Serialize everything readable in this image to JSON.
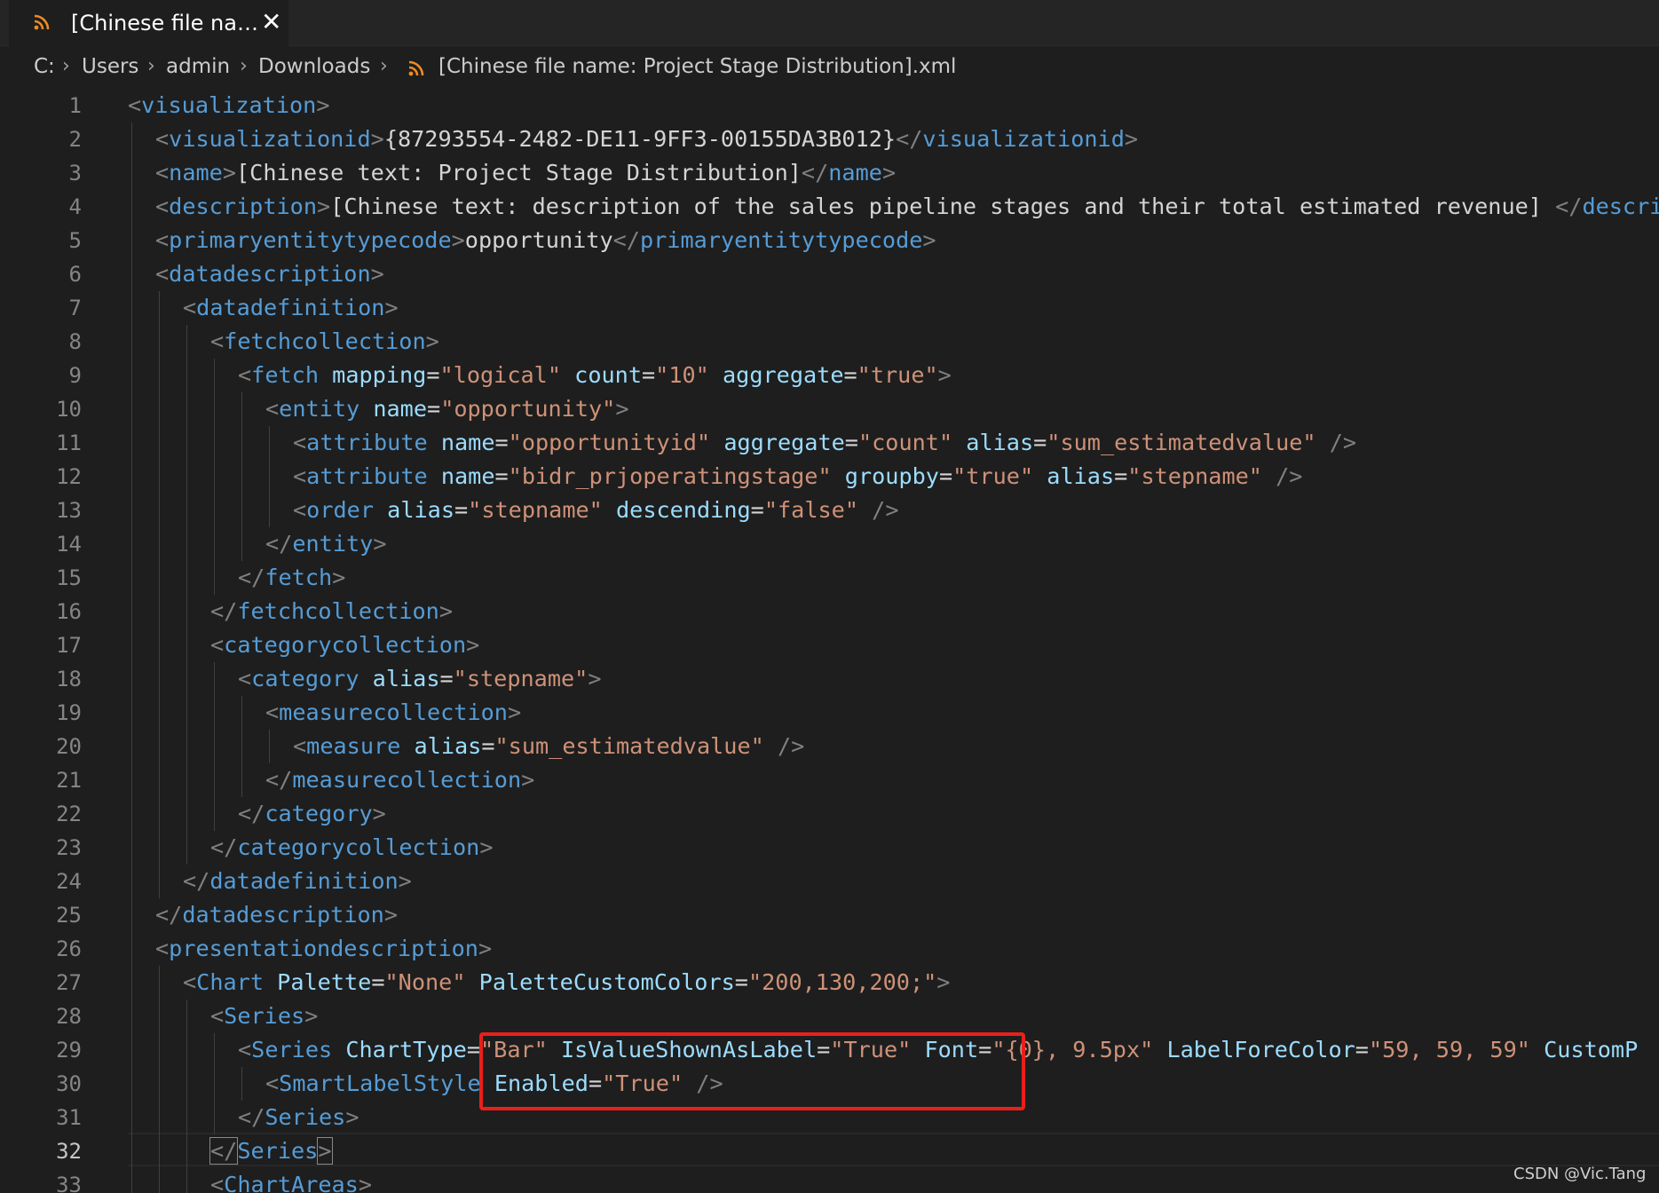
{
  "tab": {
    "title": "[Chinese file name: Project Stage Distribution].xml",
    "close_glyph": "✕"
  },
  "breadcrumb": {
    "items": [
      "C:",
      "Users",
      "admin",
      "Downloads"
    ],
    "file": "[Chinese file name: Project Stage Distribution].xml"
  },
  "editor": {
    "active_line": 32,
    "lines": [
      {
        "n": "1",
        "tokens": [
          [
            "p",
            "<"
          ],
          [
            "tag",
            "visualization"
          ],
          [
            "p",
            ">"
          ]
        ]
      },
      {
        "n": "2",
        "tokens": [
          [
            "p",
            "<"
          ],
          [
            "tag",
            "visualizationid"
          ],
          [
            "p",
            ">"
          ],
          [
            "txt",
            "{87293554-2482-DE11-9FF3-00155DA3B012}"
          ],
          [
            "p",
            "</"
          ],
          [
            "tag",
            "visualizationid"
          ],
          [
            "p",
            ">"
          ]
        ]
      },
      {
        "n": "3",
        "tokens": [
          [
            "p",
            "<"
          ],
          [
            "tag",
            "name"
          ],
          [
            "p",
            ">"
          ],
          [
            "txt",
            "[Chinese text: Project Stage Distribution]"
          ],
          [
            "p",
            "</"
          ],
          [
            "tag",
            "name"
          ],
          [
            "p",
            ">"
          ]
        ]
      },
      {
        "n": "4",
        "tokens": [
          [
            "p",
            "<"
          ],
          [
            "tag",
            "description"
          ],
          [
            "p",
            ">"
          ],
          [
            "txt",
            "[Chinese text: description of the sales pipeline stages and their total estimated revenue]"
          ],
          [
            "p",
            " </"
          ],
          [
            "tag",
            "description"
          ],
          [
            "p",
            ">"
          ]
        ]
      },
      {
        "n": "5",
        "tokens": [
          [
            "p",
            "<"
          ],
          [
            "tag",
            "primaryentitytypecode"
          ],
          [
            "p",
            ">"
          ],
          [
            "txt",
            "opportunity"
          ],
          [
            "p",
            "</"
          ],
          [
            "tag",
            "primaryentitytypecode"
          ],
          [
            "p",
            ">"
          ]
        ]
      },
      {
        "n": "6",
        "tokens": [
          [
            "p",
            "<"
          ],
          [
            "tag",
            "datadescription"
          ],
          [
            "p",
            ">"
          ]
        ]
      },
      {
        "n": "7",
        "tokens": [
          [
            "p",
            "<"
          ],
          [
            "tag",
            "datadefinition"
          ],
          [
            "p",
            ">"
          ]
        ]
      },
      {
        "n": "8",
        "tokens": [
          [
            "p",
            "<"
          ],
          [
            "tag",
            "fetchcollection"
          ],
          [
            "p",
            ">"
          ]
        ]
      },
      {
        "n": "9",
        "tokens": [
          [
            "p",
            "<"
          ],
          [
            "tag",
            "fetch"
          ],
          [
            "txt",
            " "
          ],
          [
            "attr",
            "mapping"
          ],
          [
            "txt",
            "="
          ],
          [
            "str",
            "\"logical\""
          ],
          [
            "txt",
            " "
          ],
          [
            "attr",
            "count"
          ],
          [
            "txt",
            "="
          ],
          [
            "str",
            "\"10\""
          ],
          [
            "txt",
            " "
          ],
          [
            "attr",
            "aggregate"
          ],
          [
            "txt",
            "="
          ],
          [
            "str",
            "\"true\""
          ],
          [
            "p",
            ">"
          ]
        ]
      },
      {
        "n": "10",
        "tokens": [
          [
            "p",
            "<"
          ],
          [
            "tag",
            "entity"
          ],
          [
            "txt",
            " "
          ],
          [
            "attr",
            "name"
          ],
          [
            "txt",
            "="
          ],
          [
            "str",
            "\"opportunity\""
          ],
          [
            "p",
            ">"
          ]
        ]
      },
      {
        "n": "11",
        "tokens": [
          [
            "p",
            "<"
          ],
          [
            "tag",
            "attribute"
          ],
          [
            "txt",
            " "
          ],
          [
            "attr",
            "name"
          ],
          [
            "txt",
            "="
          ],
          [
            "str",
            "\"opportunityid\""
          ],
          [
            "txt",
            " "
          ],
          [
            "attr",
            "aggregate"
          ],
          [
            "txt",
            "="
          ],
          [
            "str",
            "\"count\""
          ],
          [
            "txt",
            " "
          ],
          [
            "attr",
            "alias"
          ],
          [
            "txt",
            "="
          ],
          [
            "str",
            "\"sum_estimatedvalue\""
          ],
          [
            "p",
            " />"
          ]
        ]
      },
      {
        "n": "12",
        "tokens": [
          [
            "p",
            "<"
          ],
          [
            "tag",
            "attribute"
          ],
          [
            "txt",
            " "
          ],
          [
            "attr",
            "name"
          ],
          [
            "txt",
            "="
          ],
          [
            "str",
            "\"bidr_prjoperatingstage\""
          ],
          [
            "txt",
            " "
          ],
          [
            "attr",
            "groupby"
          ],
          [
            "txt",
            "="
          ],
          [
            "str",
            "\"true\""
          ],
          [
            "txt",
            " "
          ],
          [
            "attr",
            "alias"
          ],
          [
            "txt",
            "="
          ],
          [
            "str",
            "\"stepname\""
          ],
          [
            "p",
            " />"
          ]
        ]
      },
      {
        "n": "13",
        "tokens": [
          [
            "p",
            "<"
          ],
          [
            "tag",
            "order"
          ],
          [
            "txt",
            " "
          ],
          [
            "attr",
            "alias"
          ],
          [
            "txt",
            "="
          ],
          [
            "str",
            "\"stepname\""
          ],
          [
            "txt",
            " "
          ],
          [
            "attr",
            "descending"
          ],
          [
            "txt",
            "="
          ],
          [
            "str",
            "\"false\""
          ],
          [
            "p",
            " />"
          ]
        ]
      },
      {
        "n": "14",
        "tokens": [
          [
            "p",
            "</"
          ],
          [
            "tag",
            "entity"
          ],
          [
            "p",
            ">"
          ]
        ]
      },
      {
        "n": "15",
        "tokens": [
          [
            "p",
            "</"
          ],
          [
            "tag",
            "fetch"
          ],
          [
            "p",
            ">"
          ]
        ]
      },
      {
        "n": "16",
        "tokens": [
          [
            "p",
            "</"
          ],
          [
            "tag",
            "fetchcollection"
          ],
          [
            "p",
            ">"
          ]
        ]
      },
      {
        "n": "17",
        "tokens": [
          [
            "p",
            "<"
          ],
          [
            "tag",
            "categorycollection"
          ],
          [
            "p",
            ">"
          ]
        ]
      },
      {
        "n": "18",
        "tokens": [
          [
            "p",
            "<"
          ],
          [
            "tag",
            "category"
          ],
          [
            "txt",
            " "
          ],
          [
            "attr",
            "alias"
          ],
          [
            "txt",
            "="
          ],
          [
            "str",
            "\"stepname\""
          ],
          [
            "p",
            ">"
          ]
        ]
      },
      {
        "n": "19",
        "tokens": [
          [
            "p",
            "<"
          ],
          [
            "tag",
            "measurecollection"
          ],
          [
            "p",
            ">"
          ]
        ]
      },
      {
        "n": "20",
        "tokens": [
          [
            "p",
            "<"
          ],
          [
            "tag",
            "measure"
          ],
          [
            "txt",
            " "
          ],
          [
            "attr",
            "alias"
          ],
          [
            "txt",
            "="
          ],
          [
            "str",
            "\"sum_estimatedvalue\""
          ],
          [
            "p",
            " />"
          ]
        ]
      },
      {
        "n": "21",
        "tokens": [
          [
            "p",
            "</"
          ],
          [
            "tag",
            "measurecollection"
          ],
          [
            "p",
            ">"
          ]
        ]
      },
      {
        "n": "22",
        "tokens": [
          [
            "p",
            "</"
          ],
          [
            "tag",
            "category"
          ],
          [
            "p",
            ">"
          ]
        ]
      },
      {
        "n": "23",
        "tokens": [
          [
            "p",
            "</"
          ],
          [
            "tag",
            "categorycollection"
          ],
          [
            "p",
            ">"
          ]
        ]
      },
      {
        "n": "24",
        "tokens": [
          [
            "p",
            "</"
          ],
          [
            "tag",
            "datadefinition"
          ],
          [
            "p",
            ">"
          ]
        ]
      },
      {
        "n": "25",
        "tokens": [
          [
            "p",
            "</"
          ],
          [
            "tag",
            "datadescription"
          ],
          [
            "p",
            ">"
          ]
        ]
      },
      {
        "n": "26",
        "tokens": [
          [
            "p",
            "<"
          ],
          [
            "tag",
            "presentationdescription"
          ],
          [
            "p",
            ">"
          ]
        ]
      },
      {
        "n": "27",
        "tokens": [
          [
            "p",
            "<"
          ],
          [
            "tag",
            "Chart"
          ],
          [
            "txt",
            " "
          ],
          [
            "attr",
            "Palette"
          ],
          [
            "txt",
            "="
          ],
          [
            "str",
            "\"None\""
          ],
          [
            "txt",
            " "
          ],
          [
            "attr",
            "PaletteCustomColors"
          ],
          [
            "txt",
            "="
          ],
          [
            "str",
            "\"200,130,200;\""
          ],
          [
            "p",
            ">"
          ]
        ]
      },
      {
        "n": "28",
        "tokens": [
          [
            "p",
            "<"
          ],
          [
            "tag",
            "Series"
          ],
          [
            "p",
            ">"
          ]
        ]
      },
      {
        "n": "29",
        "tokens": [
          [
            "p",
            "<"
          ],
          [
            "tag",
            "Series"
          ],
          [
            "txt",
            " "
          ],
          [
            "attr",
            "ChartType"
          ],
          [
            "txt",
            "="
          ],
          [
            "str",
            "\"Bar\""
          ],
          [
            "txt",
            " "
          ],
          [
            "attr",
            "IsValueShownAsLabel"
          ],
          [
            "txt",
            "="
          ],
          [
            "str",
            "\"True\""
          ],
          [
            "txt",
            " "
          ],
          [
            "attr",
            "Font"
          ],
          [
            "txt",
            "="
          ],
          [
            "str",
            "\"{0}, 9.5px\""
          ],
          [
            "txt",
            " "
          ],
          [
            "attr",
            "LabelForeColor"
          ],
          [
            "txt",
            "="
          ],
          [
            "str",
            "\"59, 59, 59\""
          ],
          [
            "txt",
            " "
          ],
          [
            "attr",
            "CustomP"
          ]
        ]
      },
      {
        "n": "30",
        "tokens": [
          [
            "p",
            "<"
          ],
          [
            "tag",
            "SmartLabelStyle"
          ],
          [
            "txt",
            " "
          ],
          [
            "attr",
            "Enabled"
          ],
          [
            "txt",
            "="
          ],
          [
            "str",
            "\"True\""
          ],
          [
            "p",
            " />"
          ]
        ]
      },
      {
        "n": "31",
        "tokens": [
          [
            "p",
            "</"
          ],
          [
            "tag",
            "Series"
          ],
          [
            "p",
            ">"
          ]
        ]
      },
      {
        "n": "32",
        "tokens": [
          [
            "p",
            "</"
          ],
          [
            "tag",
            "Series"
          ],
          [
            "p",
            ">"
          ]
        ]
      },
      {
        "n": "33",
        "tokens": [
          [
            "p",
            "<"
          ],
          [
            "tag",
            "ChartAreas"
          ],
          [
            "p",
            ">"
          ]
        ]
      }
    ]
  },
  "watermark": "CSDN @Vic.Tang",
  "colors": {
    "background": "#1e1e1e",
    "tag": "#569cd6",
    "attribute": "#9cdcfe",
    "string": "#ce9178",
    "punctuation": "#808080",
    "callout": "#e8201c",
    "rss": "#f08a24"
  }
}
